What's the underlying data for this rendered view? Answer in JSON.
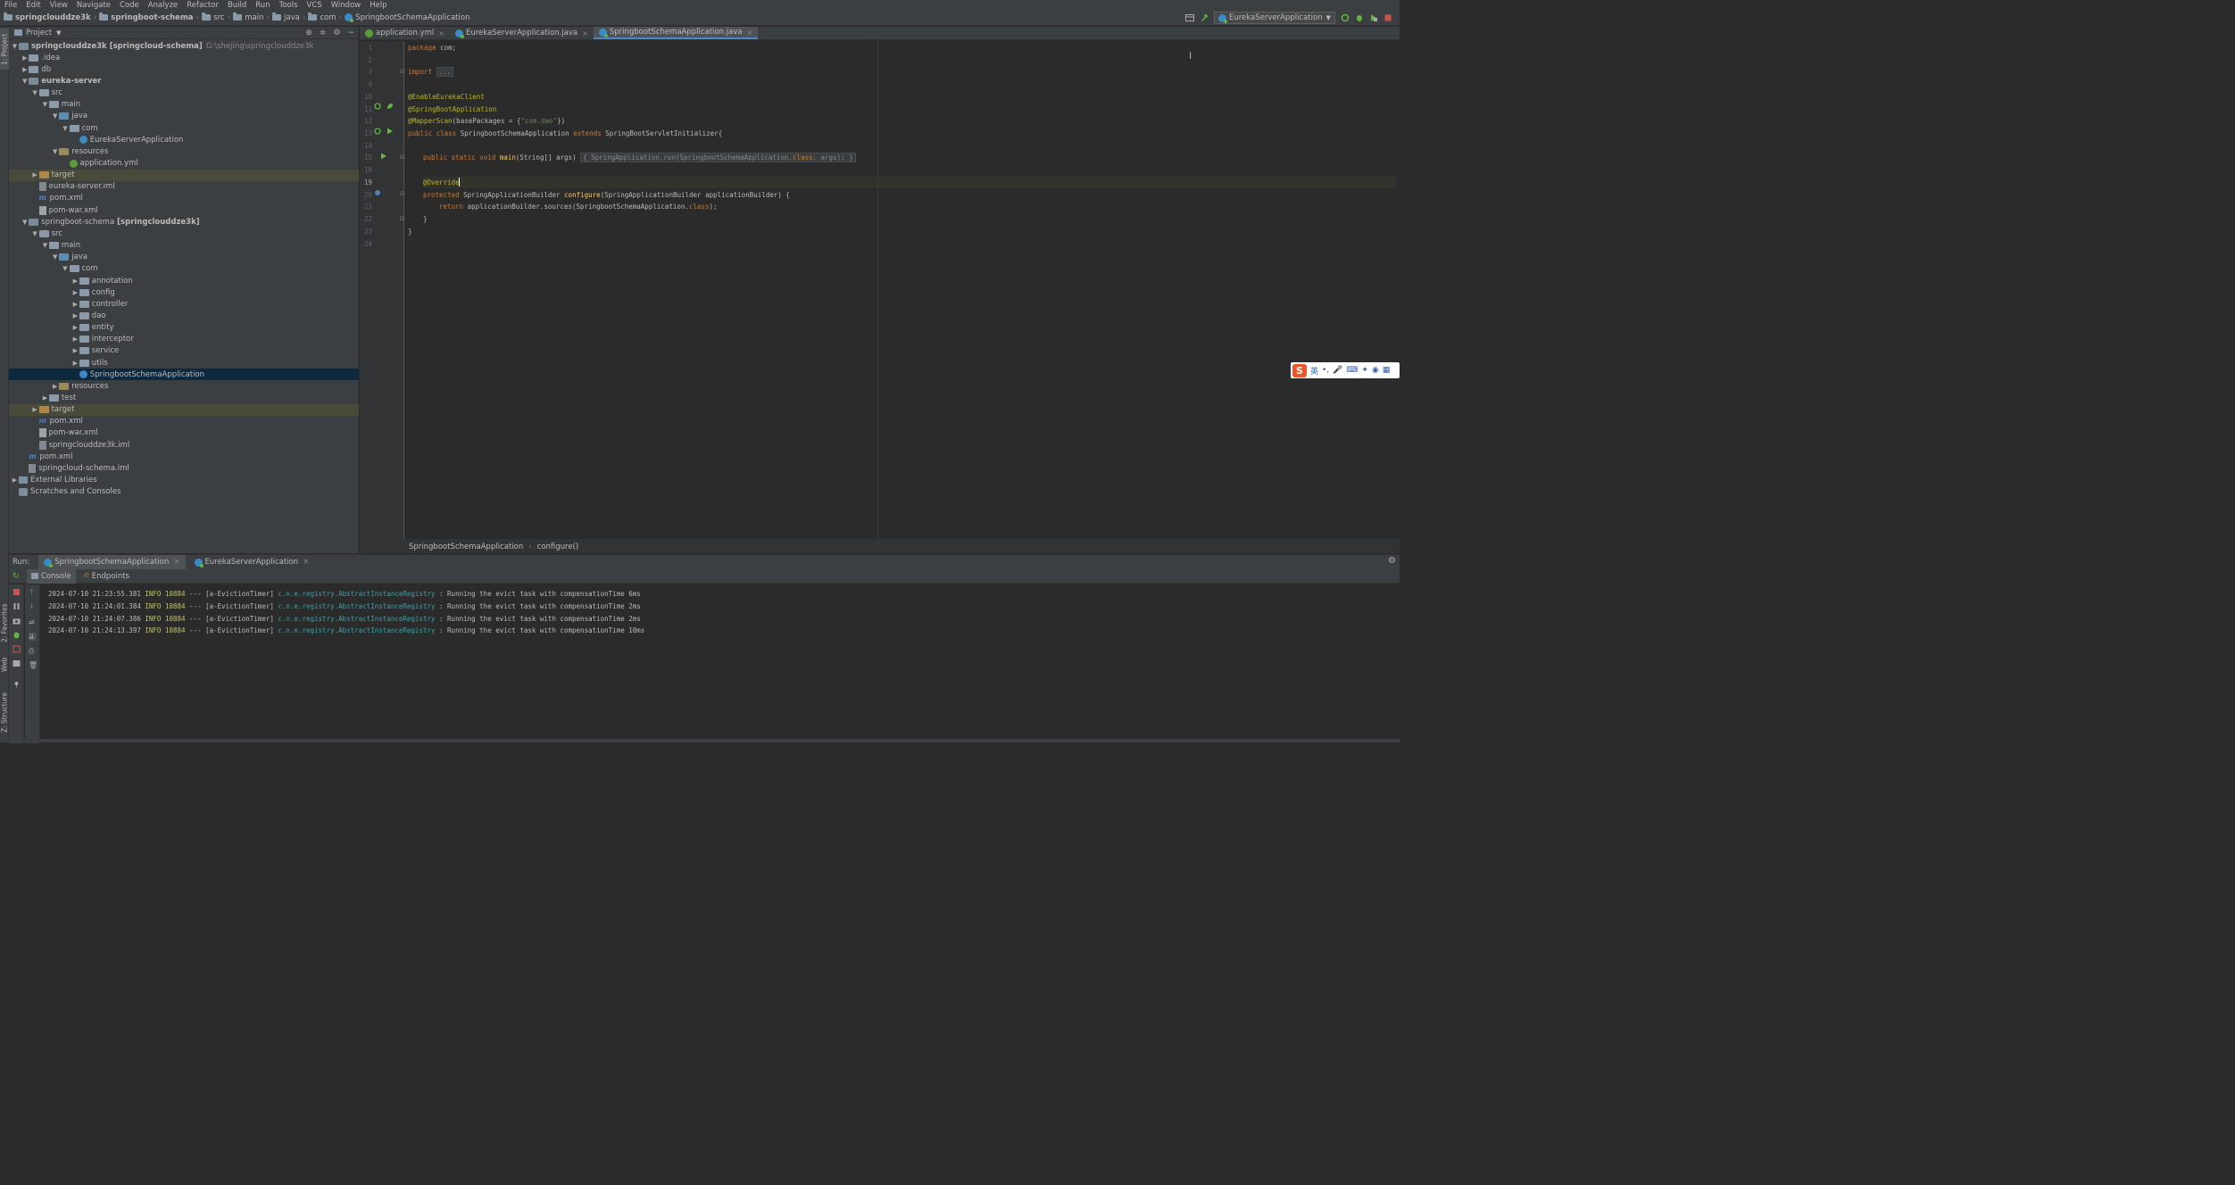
{
  "menu": [
    "File",
    "Edit",
    "View",
    "Navigate",
    "Code",
    "Analyze",
    "Refactor",
    "Build",
    "Run",
    "Tools",
    "VCS",
    "Window",
    "Help"
  ],
  "breadcrumb": [
    "springclouddze3k",
    "springboot-schema",
    "src",
    "main",
    "java",
    "com",
    "SpringbootSchemaApplication"
  ],
  "run_config": "EurekaServerApplication",
  "project_panel": {
    "title": "Project",
    "tree": [
      {
        "label": "springclouddze3k",
        "extra": "[springcloud-schema]",
        "path": "G:\\shejing\\springclouddze3k",
        "depth": 0,
        "arrow": "down",
        "icon": "module",
        "bold": true
      },
      {
        "label": ".idea",
        "depth": 1,
        "arrow": "right",
        "icon": "folder"
      },
      {
        "label": "db",
        "depth": 1,
        "arrow": "right",
        "icon": "folder"
      },
      {
        "label": "eureka-server",
        "depth": 1,
        "arrow": "down",
        "icon": "module",
        "bold": true
      },
      {
        "label": "src",
        "depth": 2,
        "arrow": "down",
        "icon": "folder"
      },
      {
        "label": "main",
        "depth": 3,
        "arrow": "down",
        "icon": "folder"
      },
      {
        "label": "java",
        "depth": 4,
        "arrow": "down",
        "icon": "src"
      },
      {
        "label": "com",
        "depth": 5,
        "arrow": "down",
        "icon": "folder"
      },
      {
        "label": "EurekaServerApplication",
        "depth": 6,
        "arrow": "",
        "icon": "class"
      },
      {
        "label": "resources",
        "depth": 4,
        "arrow": "down",
        "icon": "res"
      },
      {
        "label": "application.yml",
        "depth": 5,
        "arrow": "",
        "icon": "yml"
      },
      {
        "label": "target",
        "depth": 2,
        "arrow": "right",
        "icon": "target",
        "excluded": true
      },
      {
        "label": "eureka-server.iml",
        "depth": 2,
        "arrow": "",
        "icon": "iml"
      },
      {
        "label": "pom.xml",
        "depth": 2,
        "arrow": "",
        "icon": "xml"
      },
      {
        "label": "pom-war.xml",
        "depth": 2,
        "arrow": "",
        "icon": "file"
      },
      {
        "label": "springboot-schema",
        "extra": "[springclouddze3k]",
        "depth": 1,
        "arrow": "down",
        "icon": "module"
      },
      {
        "label": "src",
        "depth": 2,
        "arrow": "down",
        "icon": "folder"
      },
      {
        "label": "main",
        "depth": 3,
        "arrow": "down",
        "icon": "folder"
      },
      {
        "label": "java",
        "depth": 4,
        "arrow": "down",
        "icon": "src"
      },
      {
        "label": "com",
        "depth": 5,
        "arrow": "down",
        "icon": "folder"
      },
      {
        "label": "annotation",
        "depth": 6,
        "arrow": "right",
        "icon": "folder"
      },
      {
        "label": "config",
        "depth": 6,
        "arrow": "right",
        "icon": "folder"
      },
      {
        "label": "controller",
        "depth": 6,
        "arrow": "right",
        "icon": "folder"
      },
      {
        "label": "dao",
        "depth": 6,
        "arrow": "right",
        "icon": "folder"
      },
      {
        "label": "entity",
        "depth": 6,
        "arrow": "right",
        "icon": "folder"
      },
      {
        "label": "interceptor",
        "depth": 6,
        "arrow": "right",
        "icon": "folder"
      },
      {
        "label": "service",
        "depth": 6,
        "arrow": "right",
        "icon": "folder"
      },
      {
        "label": "utils",
        "depth": 6,
        "arrow": "right",
        "icon": "folder"
      },
      {
        "label": "SpringbootSchemaApplication",
        "depth": 6,
        "arrow": "",
        "icon": "class",
        "selected": true
      },
      {
        "label": "resources",
        "depth": 4,
        "arrow": "right",
        "icon": "res"
      },
      {
        "label": "test",
        "depth": 3,
        "arrow": "right",
        "icon": "folder"
      },
      {
        "label": "target",
        "depth": 2,
        "arrow": "right",
        "icon": "target",
        "excluded": true
      },
      {
        "label": "pom.xml",
        "depth": 2,
        "arrow": "",
        "icon": "xml"
      },
      {
        "label": "pom-war.xml",
        "depth": 2,
        "arrow": "",
        "icon": "file"
      },
      {
        "label": "springclouddze3k.iml",
        "depth": 2,
        "arrow": "",
        "icon": "iml"
      },
      {
        "label": "pom.xml",
        "depth": 1,
        "arrow": "",
        "icon": "xml"
      },
      {
        "label": "springcloud-schema.iml",
        "depth": 1,
        "arrow": "",
        "icon": "iml"
      },
      {
        "label": "External Libraries",
        "depth": 0,
        "arrow": "right",
        "icon": "lib"
      },
      {
        "label": "Scratches and Consoles",
        "depth": 0,
        "arrow": "",
        "icon": "scratch"
      }
    ]
  },
  "editor_tabs": [
    {
      "label": "application.yml",
      "active": false,
      "icon": "yml"
    },
    {
      "label": "EurekaServerApplication.java",
      "active": false,
      "icon": "class"
    },
    {
      "label": "SpringbootSchemaApplication.java",
      "active": true,
      "icon": "class"
    }
  ],
  "code_lines": [
    "1",
    "2",
    "3",
    "9",
    "10",
    "11",
    "12",
    "13",
    "14",
    "15",
    "18",
    "19",
    "20",
    "21",
    "22",
    "23",
    "24"
  ],
  "code": {
    "l1_kw": "package",
    "l1_rest": " com;",
    "l3_kw": "import",
    "l3_fold": "...",
    "l10": "@EnableEurekaClient",
    "l11": "@SpringBootApplication",
    "l12_ann": "@MapperScan",
    "l12_a": "(basePackages = {",
    "l12_str": "\"com.dao\"",
    "l12_b": "})",
    "l13_kw1": "public class",
    "l13_name": " SpringbootSchemaApplication ",
    "l13_kw2": "extends",
    "l13_rest": " SpringBootServletInitializer{",
    "l15_kw": "public static void",
    "l15_fn": "main",
    "l15_a": "(String[] args) ",
    "l15_b": "{ SpringApplication.",
    "l15_run": "run",
    "l15_c": "(SpringbootSchemaApplication.",
    "l15_cls": "class",
    "l15_d": ", args); }",
    "l19": "@Override",
    "l20_kw": "protected",
    "l20_a": " SpringApplicationBuilder ",
    "l20_fn": "configure",
    "l20_b": "(SpringApplicationBuilder applicationBuilder) {",
    "l21_kw": "return",
    "l21_a": " applicationBuilder.sources(SpringbootSchemaApplication.",
    "l21_cls": "class",
    "l21_b": ");",
    "l22": "}",
    "l23": "}"
  },
  "code_breadcrumb": [
    "SpringbootSchemaApplication",
    "configure()"
  ],
  "run_panel": {
    "label": "Run:",
    "tabs": [
      "SpringbootSchemaApplication",
      "EurekaServerApplication"
    ],
    "subtabs": [
      "Console",
      "Endpoints"
    ],
    "logs": [
      {
        "ts": "2024-07-10 21:23:55.381",
        "level": "INFO",
        "pid": "10884",
        "sep": "---",
        "thread": "[a-EvictionTimer]",
        "logger": "c.n.e.registry.AbstractInstanceRegistry",
        "msg": ": Running the evict task with compensationTime 6ms"
      },
      {
        "ts": "2024-07-10 21:24:01.384",
        "level": "INFO",
        "pid": "10884",
        "sep": "---",
        "thread": "[a-EvictionTimer]",
        "logger": "c.n.e.registry.AbstractInstanceRegistry",
        "msg": ": Running the evict task with compensationTime 2ms"
      },
      {
        "ts": "2024-07-10 21:24:07.386",
        "level": "INFO",
        "pid": "10884",
        "sep": "---",
        "thread": "[a-EvictionTimer]",
        "logger": "c.n.e.registry.AbstractInstanceRegistry",
        "msg": ": Running the evict task with compensationTime 2ms"
      },
      {
        "ts": "2024-07-10 21:24:13.397",
        "level": "INFO",
        "pid": "10884",
        "sep": "---",
        "thread": "[a-EvictionTimer]",
        "logger": "c.n.e.registry.AbstractInstanceRegistry",
        "msg": ": Running the evict task with compensationTime 10ms"
      }
    ]
  },
  "side_tabs": {
    "project": "1: Project",
    "favorites": "2: Favorites",
    "web": "Web",
    "structure": "Z: Structure"
  },
  "ime": {
    "logo": "S",
    "lang": "英"
  },
  "colors": {
    "bg": "#2b2b2b",
    "panel": "#3c3f41",
    "selection": "#0d293e",
    "keyword": "#cc7832",
    "annotation": "#bbb529",
    "string": "#6a8759",
    "function": "#ffc66d",
    "logger": "#3ba0a8",
    "run_green": "#62b543",
    "stop_red": "#c75450"
  }
}
